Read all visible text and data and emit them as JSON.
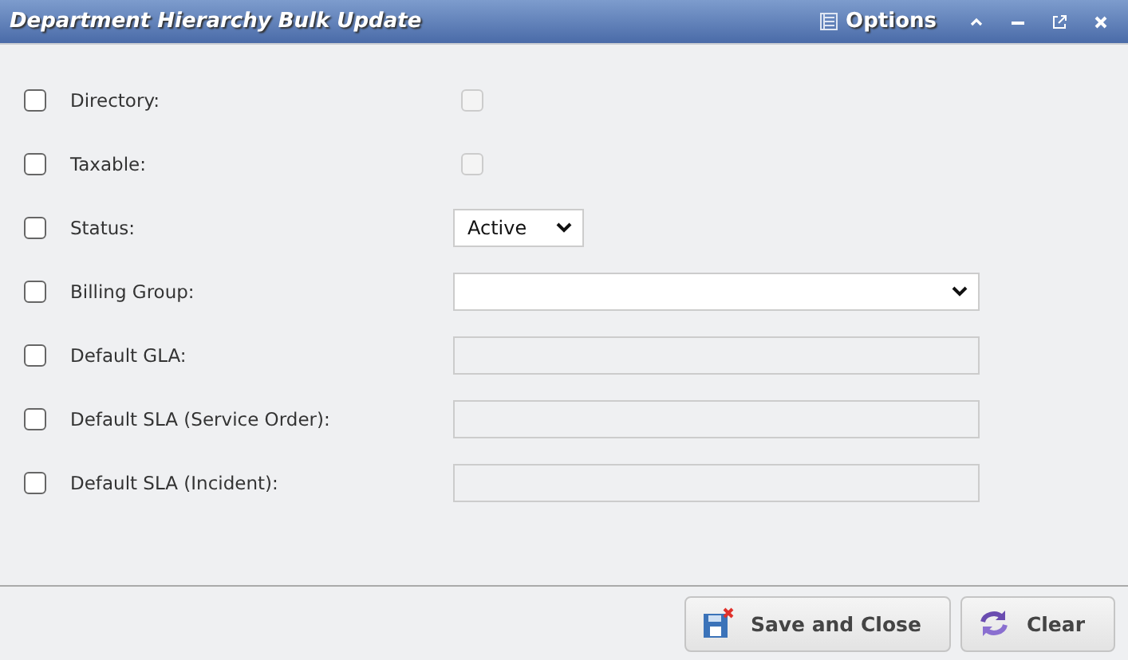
{
  "window": {
    "title": "Department Hierarchy Bulk Update",
    "options_label": "Options"
  },
  "fields": [
    {
      "label": "Directory:",
      "included": false,
      "kind": "checkbox",
      "checked": false,
      "disabled": true
    },
    {
      "label": "Taxable:",
      "included": false,
      "kind": "checkbox",
      "checked": false,
      "disabled": true
    },
    {
      "label": "Status:",
      "included": false,
      "kind": "compact-select",
      "value": "Active"
    },
    {
      "label": "Billing Group:",
      "included": false,
      "kind": "select"
    },
    {
      "label": "Default GLA:",
      "included": false,
      "kind": "input"
    },
    {
      "label": "Default SLA (Service Order):",
      "included": false,
      "kind": "input"
    },
    {
      "label": "Default SLA (Incident):",
      "included": false,
      "kind": "input"
    }
  ],
  "buttons": [
    {
      "label": "Save and Close",
      "kind": "save"
    },
    {
      "label": "Clear",
      "kind": "clear"
    }
  ]
}
